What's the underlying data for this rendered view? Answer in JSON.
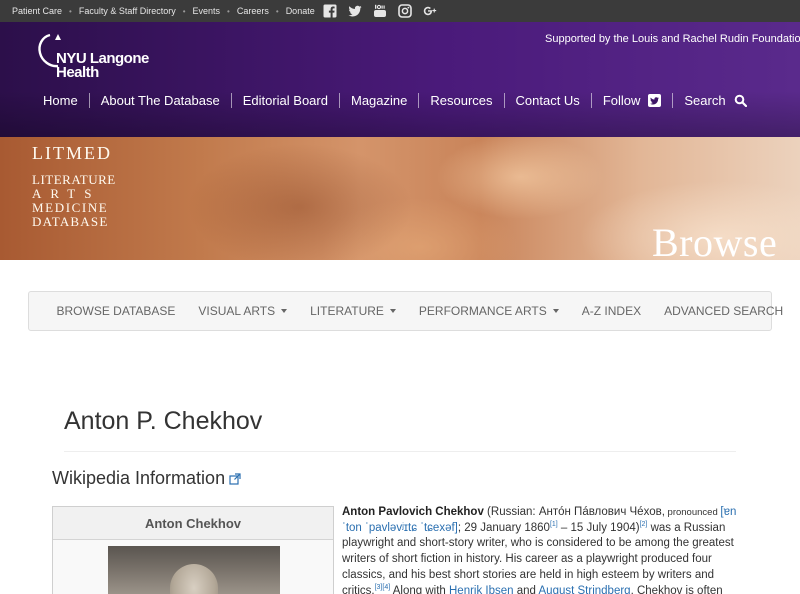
{
  "utility_bar": {
    "links": [
      "Patient Care",
      "Faculty & Staff Directory",
      "Events",
      "Careers",
      "Donate"
    ],
    "social": [
      "facebook-icon",
      "twitter-icon",
      "youtube-icon",
      "instagram-icon",
      "google-plus-icon"
    ]
  },
  "header": {
    "logo_line1": "NYU Langone",
    "logo_line2": "Health",
    "supported_by": "Supported by the Louis and Rachel Rudin Foundation",
    "nav": [
      "Home",
      "About The Database",
      "Editorial Board",
      "Magazine",
      "Resources",
      "Contact Us",
      "Follow",
      "Search"
    ]
  },
  "banner": {
    "litmed": "LITMED",
    "line1": "LITERATURE",
    "line2": "ARTS",
    "line3": "MEDICINE",
    "line4": "DATABASE",
    "section": "Browse"
  },
  "subnav": {
    "items": [
      "BROWSE DATABASE",
      "VISUAL ARTS",
      "LITERATURE",
      "PERFORMANCE ARTS",
      "A-Z INDEX",
      "ADVANCED SEARCH"
    ]
  },
  "content": {
    "title": "Anton P. Chekhov",
    "wiki_heading": "Wikipedia Information",
    "infobox_title": "Anton Chekhov",
    "article": {
      "name": "Anton Pavlovich Chekhov",
      "russian_prefix": " (Russian: Антóн Пáвлович Чéхов,",
      "pronounced": " pronounced ",
      "ipa": "[ɐnˈton ˈpavləvʲɪtɕ ˈtɕexəf]",
      "dates_1": "; 29 January 1860",
      "ref1": "[1]",
      "dates_2": " – 15 July 1904)",
      "ref2": "[2]",
      "body_1": " was a Russian playwright and short-story writer, who is considered to be among the greatest writers of short fiction in history. His career as a playwright produced four classics, and his best short stories are held in high esteem by writers and critics.",
      "ref34": "[3][4]",
      "body_2": " Along with ",
      "link1": "Henrik Ibsen",
      "and": " and ",
      "link2": "August Strindberg",
      "body_3": ", Chekhov is often referred to as one of the three"
    }
  },
  "colors": {
    "utility_bar": "#3b3b3b",
    "header_purple": "#4a1a7a",
    "link_blue": "#2a6fb0"
  }
}
